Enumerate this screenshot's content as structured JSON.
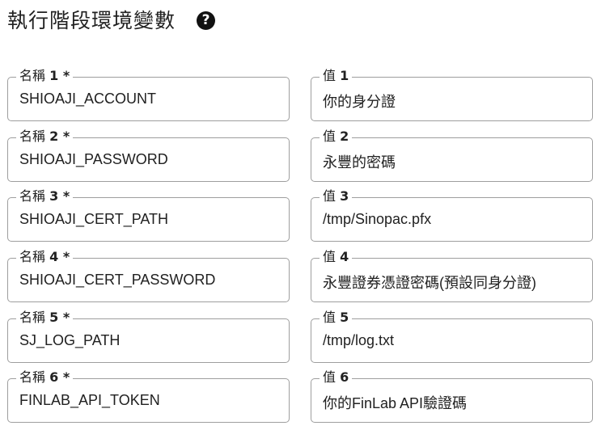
{
  "header": {
    "title": "執行階段環境變數",
    "help_icon": "?"
  },
  "rows": [
    {
      "name_label": "名稱",
      "name_num": "1 *",
      "name_value": "SHIOAJI_ACCOUNT",
      "value_label": "值",
      "value_num": "1",
      "value_value": "你的身分證"
    },
    {
      "name_label": "名稱",
      "name_num": "2 *",
      "name_value": "SHIOAJI_PASSWORD",
      "value_label": "值",
      "value_num": "2",
      "value_value": "永豐的密碼"
    },
    {
      "name_label": "名稱",
      "name_num": "3 *",
      "name_value": "SHIOAJI_CERT_PATH",
      "value_label": "值",
      "value_num": "3",
      "value_value": "/tmp/Sinopac.pfx"
    },
    {
      "name_label": "名稱",
      "name_num": "4 *",
      "name_value": "SHIOAJI_CERT_PASSWORD",
      "value_label": "值",
      "value_num": "4",
      "value_value": "永豐證券憑證密碼(預設同身分證)"
    },
    {
      "name_label": "名稱",
      "name_num": "5 *",
      "name_value": "SJ_LOG_PATH",
      "value_label": "值",
      "value_num": "5",
      "value_value": "/tmp/log.txt"
    },
    {
      "name_label": "名稱",
      "name_num": "6 *",
      "name_value": "FINLAB_API_TOKEN",
      "value_label": "值",
      "value_num": "6",
      "value_value": "你的FinLab API驗證碼"
    }
  ]
}
